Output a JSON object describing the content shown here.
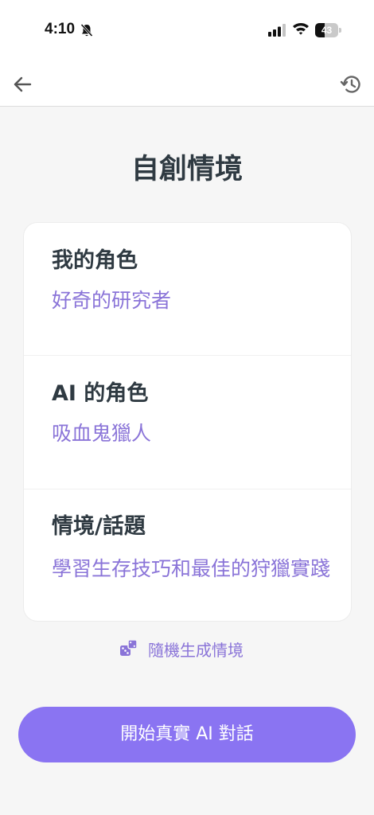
{
  "status_bar": {
    "time": "4:10",
    "battery_level": "43",
    "icons": [
      "bell-off-icon",
      "signal-icon",
      "wifi-icon",
      "battery-icon"
    ]
  },
  "nav": {
    "back_icon": "arrow-left-icon",
    "history_icon": "history-icon"
  },
  "page": {
    "title": "自創情境"
  },
  "sections": [
    {
      "label": "我的角色",
      "value": "好奇的研究者"
    },
    {
      "label": "AI 的角色",
      "value": "吸血鬼獵人"
    },
    {
      "label": "情境/話題",
      "value": "學習生存技巧和最佳的狩獵實踐"
    }
  ],
  "random_button": {
    "icon": "dice-icon",
    "label": "隨機生成情境"
  },
  "start_button": {
    "label": "開始真實 AI 對話"
  },
  "colors": {
    "accent": "#8a74f2",
    "accent_text": "#8a74d8",
    "title_text": "#2f3a42",
    "background": "#f6f6f6"
  }
}
